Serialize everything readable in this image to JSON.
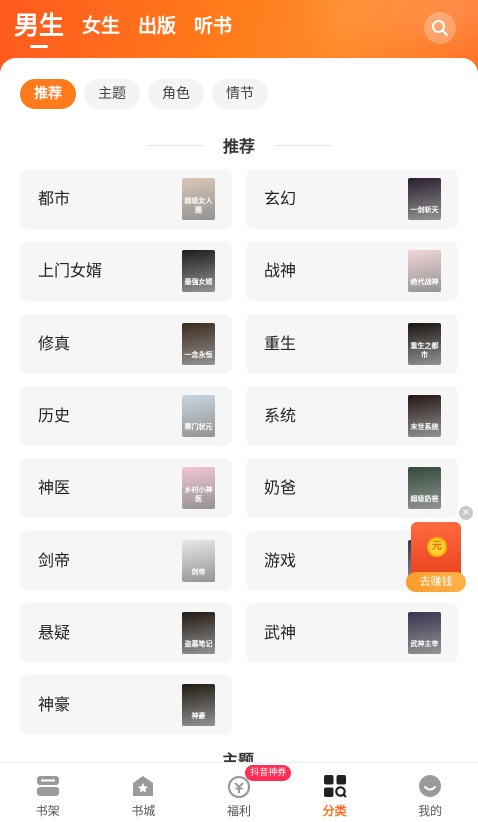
{
  "top_tabs": [
    "男生",
    "女生",
    "出版",
    "听书"
  ],
  "chips": [
    "推荐",
    "主题",
    "角色",
    "情节"
  ],
  "section_title": "推荐",
  "categories": [
    {
      "label": "都市",
      "cover_text": "超级女人圈",
      "cover_bg": "#d9c7b5"
    },
    {
      "label": "玄幻",
      "cover_text": "一剑斩天",
      "cover_bg": "#2a1f2e"
    },
    {
      "label": "上门女婿",
      "cover_text": "最强女婿",
      "cover_bg": "#1e1e22"
    },
    {
      "label": "战神",
      "cover_text": "绝代战神",
      "cover_bg": "#f0d6d6"
    },
    {
      "label": "修真",
      "cover_text": "一念永恒",
      "cover_bg": "#3a2a1e"
    },
    {
      "label": "重生",
      "cover_text": "重生之都市",
      "cover_bg": "#1a1411"
    },
    {
      "label": "历史",
      "cover_text": "寒门状元",
      "cover_bg": "#c9d6e0"
    },
    {
      "label": "系统",
      "cover_text": "末世系统",
      "cover_bg": "#241612"
    },
    {
      "label": "神医",
      "cover_text": "乡村小神医",
      "cover_bg": "#f2c6d6"
    },
    {
      "label": "奶爸",
      "cover_text": "超级奶爸",
      "cover_bg": "#324a3a"
    },
    {
      "label": "剑帝",
      "cover_text": "剑帝",
      "cover_bg": "#e8e8e8"
    },
    {
      "label": "游戏",
      "cover_text": "网游",
      "cover_bg": "#2d3a50"
    },
    {
      "label": "悬疑",
      "cover_text": "盗墓笔记",
      "cover_bg": "#231a14"
    },
    {
      "label": "武神",
      "cover_text": "武神主宰",
      "cover_bg": "#3a3350"
    },
    {
      "label": "神豪",
      "cover_text": "神豪",
      "cover_bg": "#201a12"
    }
  ],
  "next_section_peek": "主题",
  "float_ad": {
    "close": "×",
    "coin": "元",
    "button": "去赚钱"
  },
  "bottom_nav": [
    {
      "label": "书架",
      "icon": "bookshelf-icon"
    },
    {
      "label": "书城",
      "icon": "bookstore-icon"
    },
    {
      "label": "福利",
      "icon": "welfare-icon",
      "badge": "抖音神券"
    },
    {
      "label": "分类",
      "icon": "category-icon",
      "active": true
    },
    {
      "label": "我的",
      "icon": "profile-icon"
    }
  ],
  "colors": {
    "accent": "#ff7a1a",
    "header": "#ff6b1a",
    "badge": "#ff2d55"
  }
}
